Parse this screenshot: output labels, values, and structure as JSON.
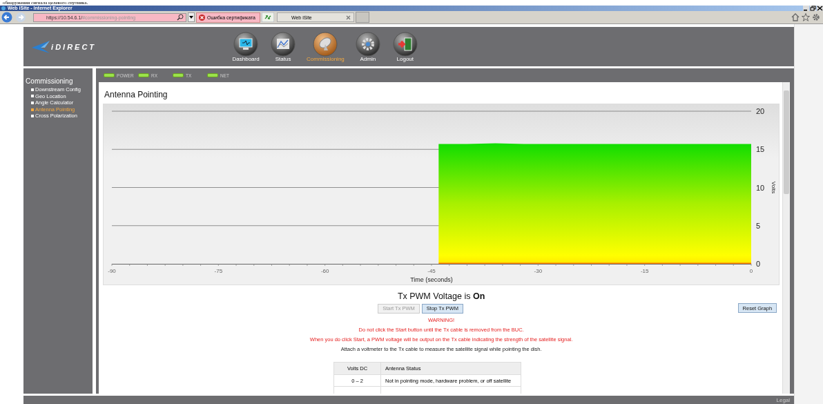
{
  "document_line": "обнаружения сигнала целевого спутника.",
  "window": {
    "title": "Web iSite - Internet Explorer"
  },
  "browser": {
    "url_host": "https://10.54.6.1/",
    "url_path": "#commissioning-pointing",
    "certificate_error": "Ошибка сертификата",
    "tab": "Web iSite"
  },
  "header": {
    "logo": "iDIRECT",
    "nav": [
      {
        "label": "Dashboard",
        "selected": false
      },
      {
        "label": "Status",
        "selected": false
      },
      {
        "label": "Commissioning",
        "selected": true
      },
      {
        "label": "Admin",
        "selected": false
      },
      {
        "label": "Logout",
        "selected": false
      }
    ]
  },
  "sidebar": {
    "title": "Commissioning",
    "items": [
      {
        "label": "Downstream Config",
        "selected": false
      },
      {
        "label": "Geo Location",
        "selected": false
      },
      {
        "label": "Angle Calculator",
        "selected": false
      },
      {
        "label": "Antenna Pointing",
        "selected": true
      },
      {
        "label": "Cross Polarization",
        "selected": false
      }
    ]
  },
  "leds": [
    {
      "label": "POWER",
      "on": true
    },
    {
      "label": "RX",
      "on": true
    },
    {
      "label": "TX",
      "on": true
    },
    {
      "label": "NET",
      "on": true
    }
  ],
  "page_title": "Antenna Pointing",
  "chart_data": {
    "type": "area",
    "xlabel": "Time (seconds)",
    "ylabel": "Volts",
    "x": [
      -44,
      -40,
      -36,
      -32,
      -28,
      -24,
      -20,
      -16,
      -12,
      -8,
      -4,
      0
    ],
    "series": [
      {
        "color": "#10dd00",
        "values": [
          15.7,
          15.7,
          15.8,
          15.7,
          15.7,
          15.7,
          15.7,
          15.7,
          15.7,
          15.7,
          15.7,
          15.7
        ]
      }
    ],
    "xlim": [
      -90,
      0
    ],
    "ylim": [
      0,
      20
    ],
    "grid": true,
    "xticks": [
      -90,
      -75,
      -60,
      -45,
      -30,
      -15,
      0
    ],
    "yticks": [
      0,
      5,
      10,
      15,
      20
    ]
  },
  "status": {
    "prefix": "Tx PWM Voltage is",
    "value": "On"
  },
  "buttons": [
    {
      "label": "Start Tx PWM",
      "disabled": true
    },
    {
      "label": "Stop Tx PWM",
      "disabled": false
    }
  ],
  "reset_button": "Reset Graph",
  "messages": [
    {
      "text": "WARNING!",
      "kind": "warning"
    },
    {
      "text": "Do not click the Start button until the Tx cable is removed from the BUC.",
      "kind": "warning"
    },
    {
      "text": "When you do click Start, a PWM voltage will be output on the Tx cable indicating the strength of the satellite signal.",
      "kind": "warning"
    },
    {
      "text": "Attach a voltmeter to the Tx cable to measure the satellite signal while pointing the dish.",
      "kind": "info"
    }
  ],
  "table": {
    "columns": [
      "Volts DC",
      "Antenna Status"
    ],
    "rows": [
      [
        "0 – 2",
        "Not in pointing mode, hardware problem, or off satellite"
      ]
    ]
  },
  "footer": {
    "link": "Legal"
  }
}
